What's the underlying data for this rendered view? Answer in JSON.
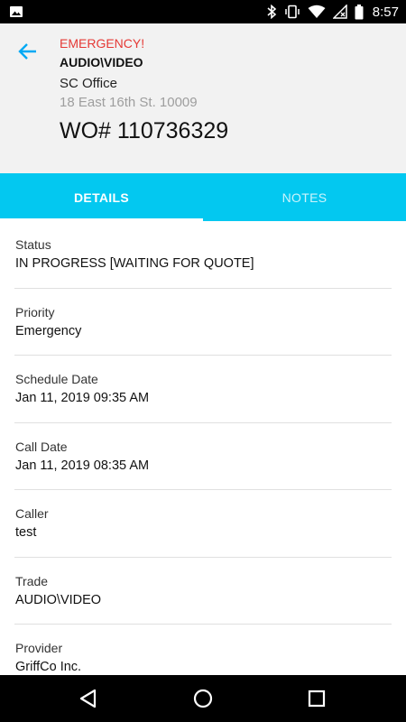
{
  "status_bar": {
    "time": "8:57",
    "icons": [
      "image-icon",
      "bluetooth-icon",
      "vibrate-icon",
      "wifi-icon",
      "signal-icon",
      "battery-icon"
    ]
  },
  "header": {
    "back_icon": "arrow-left-icon",
    "emergency_label": "EMERGENCY!",
    "category": "AUDIO\\VIDEO",
    "location": "SC Office",
    "address": "18 East 16th St. 10009",
    "wo_number": "WO# 110736329",
    "accent_color": "#03c8f0",
    "emergency_color": "#e53935"
  },
  "tabs": [
    {
      "label": "DETAILS",
      "selected": true
    },
    {
      "label": "NOTES",
      "selected": false
    }
  ],
  "details": [
    {
      "label": "Status",
      "value": "IN PROGRESS [WAITING FOR QUOTE]"
    },
    {
      "label": "Priority",
      "value": "Emergency"
    },
    {
      "label": "Schedule Date",
      "value": "Jan 11, 2019 09:35 AM"
    },
    {
      "label": "Call Date",
      "value": "Jan 11, 2019 08:35 AM"
    },
    {
      "label": "Caller",
      "value": "test"
    },
    {
      "label": "Trade",
      "value": "AUDIO\\VIDEO"
    },
    {
      "label": "Provider",
      "value": "GriffCo Inc."
    }
  ],
  "nav_bar": {
    "icons": [
      "back-triangle-icon",
      "home-circle-icon",
      "recents-square-icon"
    ]
  }
}
